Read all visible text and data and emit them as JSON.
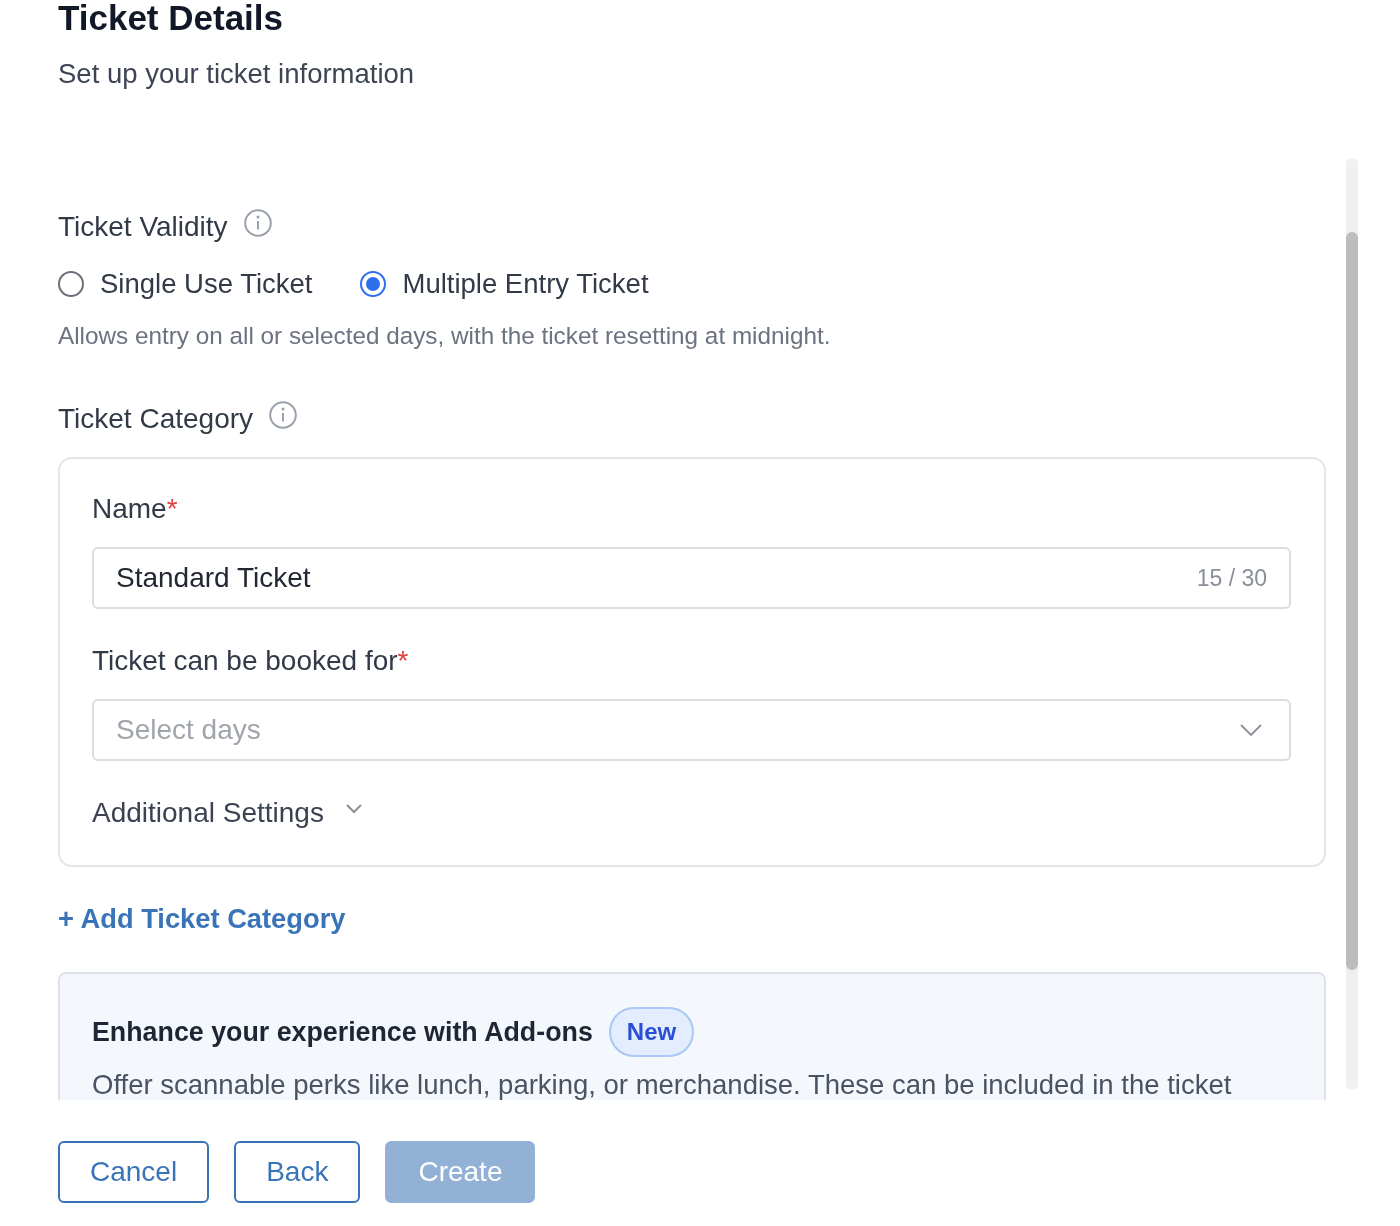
{
  "header": {
    "title": "Ticket Details",
    "subtitle": "Set up your ticket information"
  },
  "validity": {
    "label": "Ticket Validity",
    "options": [
      {
        "label": "Single Use Ticket",
        "selected": false
      },
      {
        "label": "Multiple Entry Ticket",
        "selected": true
      }
    ],
    "hint": "Allows entry on all or selected days, with the ticket resetting at midnight."
  },
  "category": {
    "label": "Ticket Category",
    "card": {
      "name_field": {
        "label": "Name",
        "required_mark": "*",
        "value": "Standard Ticket",
        "counter": "15 / 30"
      },
      "days_field": {
        "label": "Ticket can be booked for",
        "required_mark": "*",
        "placeholder": "Select days"
      },
      "additional_settings": {
        "label": "Additional Settings",
        "expanded": false
      }
    },
    "add_link": "+ Add Ticket Category"
  },
  "addons": {
    "title": "Enhance your experience with Add-ons",
    "badge": "New",
    "description": "Offer scannable perks like lunch, parking, or merchandise. These can be included in the ticket"
  },
  "buttons": [
    {
      "label": "Cancel",
      "kind": "outline",
      "disabled": false
    },
    {
      "label": "Back",
      "kind": "outline",
      "disabled": false
    },
    {
      "label": "Create",
      "kind": "primary",
      "disabled": true
    }
  ]
}
